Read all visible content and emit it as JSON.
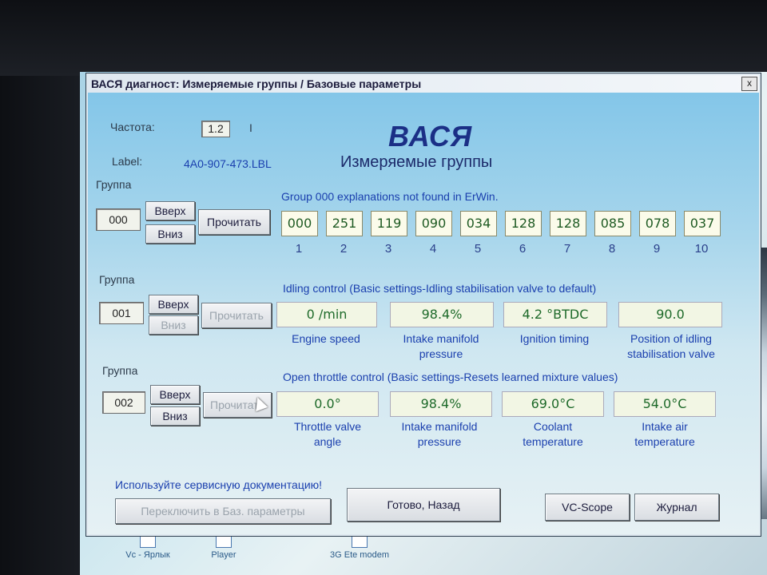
{
  "window": {
    "title": "ВАСЯ диагност: Измеряемые группы / Базовые параметры",
    "close": "x"
  },
  "header": {
    "freq_label": "Частота:",
    "freq_value": "1.2",
    "freq_suffix": "I",
    "label_label": "Label:",
    "label_value": "4A0-907-473.LBL",
    "logo": "ВАСЯ",
    "subtitle": "Измеряемые группы"
  },
  "groups": [
    {
      "label": "Группа",
      "number": "000",
      "up": "Вверх",
      "down": "Вниз",
      "read": "Прочитать",
      "description": "Group 000 explanations not found in ErWin.",
      "values": [
        "000",
        "251",
        "119",
        "090",
        "034",
        "128",
        "128",
        "085",
        "078",
        "037"
      ],
      "indices": [
        "1",
        "2",
        "3",
        "4",
        "5",
        "6",
        "7",
        "8",
        "9",
        "10"
      ]
    },
    {
      "label": "Группа",
      "number": "001",
      "up": "Вверх",
      "down": "Вниз",
      "read": "Прочитать",
      "description": "Idling control (Basic settings-Idling stabilisation valve to default)",
      "values": [
        "0 /min",
        "98.4%",
        "4.2 °BTDC",
        "90.0"
      ],
      "captions": [
        [
          "Engine speed"
        ],
        [
          "Intake manifold",
          "pressure"
        ],
        [
          "Ignition timing"
        ],
        [
          "Position of idling",
          "stabilisation valve"
        ]
      ]
    },
    {
      "label": "Группа",
      "number": "002",
      "up": "Вверх",
      "down": "Вниз",
      "read": "Прочитать",
      "description": "Open throttle control (Basic settings-Resets learned mixture values)",
      "values": [
        "0.0°",
        "98.4%",
        "69.0°C",
        "54.0°C"
      ],
      "captions": [
        [
          "Throttle valve",
          "angle"
        ],
        [
          "Intake manifold",
          "pressure"
        ],
        [
          "Coolant",
          "temperature"
        ],
        [
          "Intake air",
          "temperature"
        ]
      ]
    }
  ],
  "footer": {
    "notice": "Используйте сервисную документацию!",
    "basic_settings": "Переключить в Баз. параметры",
    "done_back": "Готово, Назад",
    "vc_scope": "VC-Scope",
    "journal": "Журнал"
  },
  "taskbar": [
    "Vc - Ярлык",
    "Player",
    "3G Ete modem"
  ]
}
